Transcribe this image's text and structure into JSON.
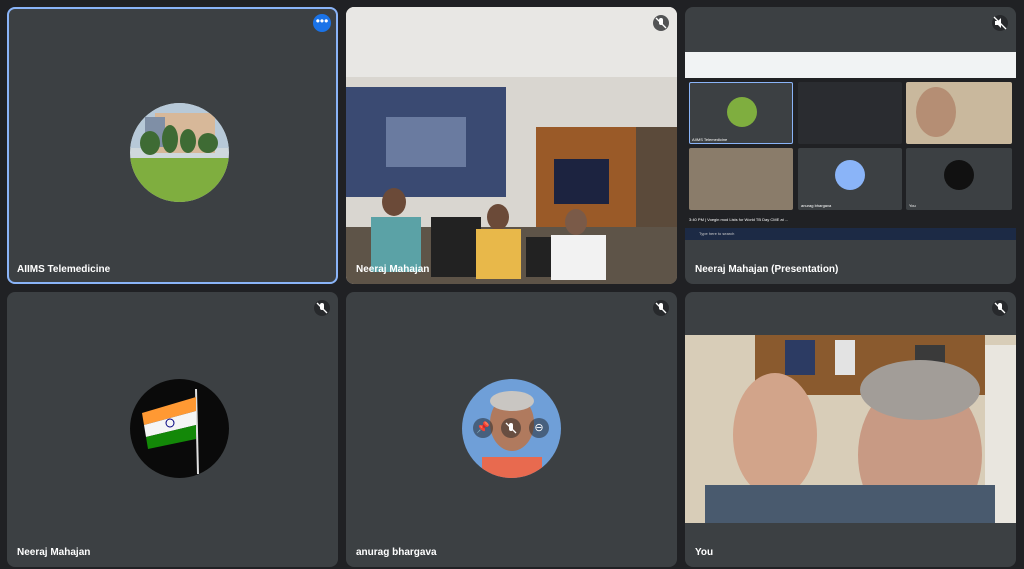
{
  "tiles": {
    "aiims": {
      "name": "AIIMS Telemedicine"
    },
    "room": {
      "name": "Neeraj Mahajan"
    },
    "presentation": {
      "name": "Neeraj Mahajan (Presentation)"
    },
    "flag": {
      "name": "Neeraj Mahajan"
    },
    "anurag": {
      "name": "anurag bhargava"
    },
    "you": {
      "name": "You"
    }
  },
  "presentation_screen": {
    "mini_names": [
      "AIIMS Telemedicine",
      "anurag bhargava",
      "You"
    ],
    "status": "3:40 PM  |  Voegin mod Lists for World TB Day CME at ...",
    "taskbar_search": "Type here to search"
  },
  "colors": {
    "active_border": "#8ab4f8",
    "tile_bg": "#3c4043",
    "page_bg": "#202124",
    "accent": "#1a73e8"
  }
}
